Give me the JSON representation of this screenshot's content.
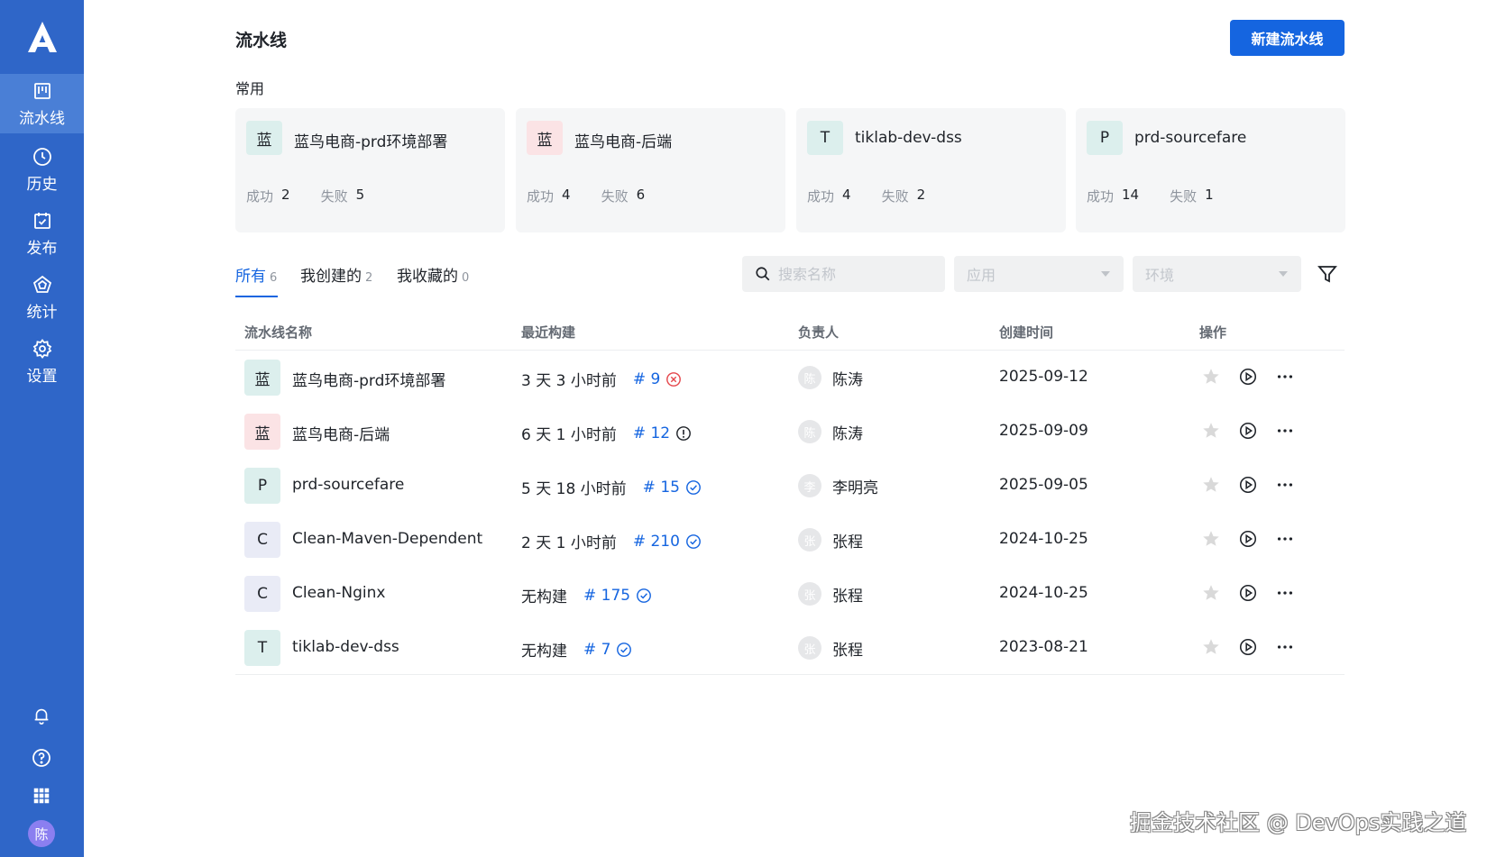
{
  "sidebar": {
    "logo": "A",
    "nav": [
      {
        "label": "流水线",
        "icon": "pipeline-icon",
        "active": true
      },
      {
        "label": "历史",
        "icon": "clock-icon",
        "active": false
      },
      {
        "label": "发布",
        "icon": "calendar-check-icon",
        "active": false
      },
      {
        "label": "统计",
        "icon": "chart-pentagon-icon",
        "active": false
      },
      {
        "label": "设置",
        "icon": "gear-icon",
        "active": false
      }
    ],
    "bottom_icons": [
      "bell-icon",
      "help-icon",
      "apps-grid-icon"
    ],
    "user_avatar": "陈"
  },
  "header": {
    "title": "流水线",
    "new_button": "新建流水线"
  },
  "favorites": {
    "title": "常用",
    "cards": [
      {
        "icon_char": "蓝",
        "name": "蓝鸟电商-prd环境部署",
        "success_label": "成功",
        "success": "2",
        "fail_label": "失败",
        "fail": "5",
        "color": "#dcefed"
      },
      {
        "icon_char": "蓝",
        "name": "蓝鸟电商-后端",
        "success_label": "成功",
        "success": "4",
        "fail_label": "失败",
        "fail": "6",
        "color": "#fbe3e5"
      },
      {
        "icon_char": "T",
        "name": "tiklab-dev-dss",
        "success_label": "成功",
        "success": "4",
        "fail_label": "失败",
        "fail": "2",
        "color": "#dcefed"
      },
      {
        "icon_char": "P",
        "name": "prd-sourcefare",
        "success_label": "成功",
        "success": "14",
        "fail_label": "失败",
        "fail": "1",
        "color": "#dcefed"
      }
    ]
  },
  "tabs": [
    {
      "label": "所有",
      "count": "6",
      "active": true
    },
    {
      "label": "我创建的",
      "count": "2",
      "active": false
    },
    {
      "label": "我收藏的",
      "count": "0",
      "active": false
    }
  ],
  "filters": {
    "search_placeholder": "搜索名称",
    "app_placeholder": "应用",
    "env_placeholder": "环境"
  },
  "table": {
    "headers": [
      "流水线名称",
      "最近构建",
      "负责人",
      "创建时间",
      "操作"
    ],
    "rows": [
      {
        "icon_char": "蓝",
        "icon_color": "#dcefed",
        "name": "蓝鸟电商-prd环境部署",
        "last_build": "3 天 3 小时前",
        "build_no": "# 9",
        "status": "failed",
        "owner_avatar": "陈",
        "owner": "陈涛",
        "created": "2025-09-12"
      },
      {
        "icon_char": "蓝",
        "icon_color": "#fbe3e5",
        "name": "蓝鸟电商-后端",
        "last_build": "6 天 1 小时前",
        "build_no": "# 12",
        "status": "warning",
        "owner_avatar": "陈",
        "owner": "陈涛",
        "created": "2025-09-09"
      },
      {
        "icon_char": "P",
        "icon_color": "#dcefed",
        "name": "prd-sourcefare",
        "last_build": "5 天 18 小时前",
        "build_no": "# 15",
        "status": "success",
        "owner_avatar": "李",
        "owner": "李明亮",
        "created": "2025-09-05"
      },
      {
        "icon_char": "C",
        "icon_color": "#e9ebf6",
        "name": "Clean-Maven-Dependent",
        "last_build": "2 天 1 小时前",
        "build_no": "# 210",
        "status": "success",
        "owner_avatar": "张",
        "owner": "张程",
        "created": "2024-10-25"
      },
      {
        "icon_char": "C",
        "icon_color": "#e9ebf6",
        "name": "Clean-Nginx",
        "last_build": "无构建",
        "build_no": "# 175",
        "status": "success",
        "owner_avatar": "张",
        "owner": "张程",
        "created": "2024-10-25"
      },
      {
        "icon_char": "T",
        "icon_color": "#dcefed",
        "name": "tiklab-dev-dss",
        "last_build": "无构建",
        "build_no": "# 7",
        "status": "success",
        "owner_avatar": "张",
        "owner": "张程",
        "created": "2023-08-21"
      }
    ]
  },
  "colors": {
    "sidebar": "#2f66c8",
    "primary": "#1565e0",
    "fail": "#e5484d",
    "success": "#1565e0"
  },
  "watermark": "掘金技术社区 @ DevOps实践之道"
}
